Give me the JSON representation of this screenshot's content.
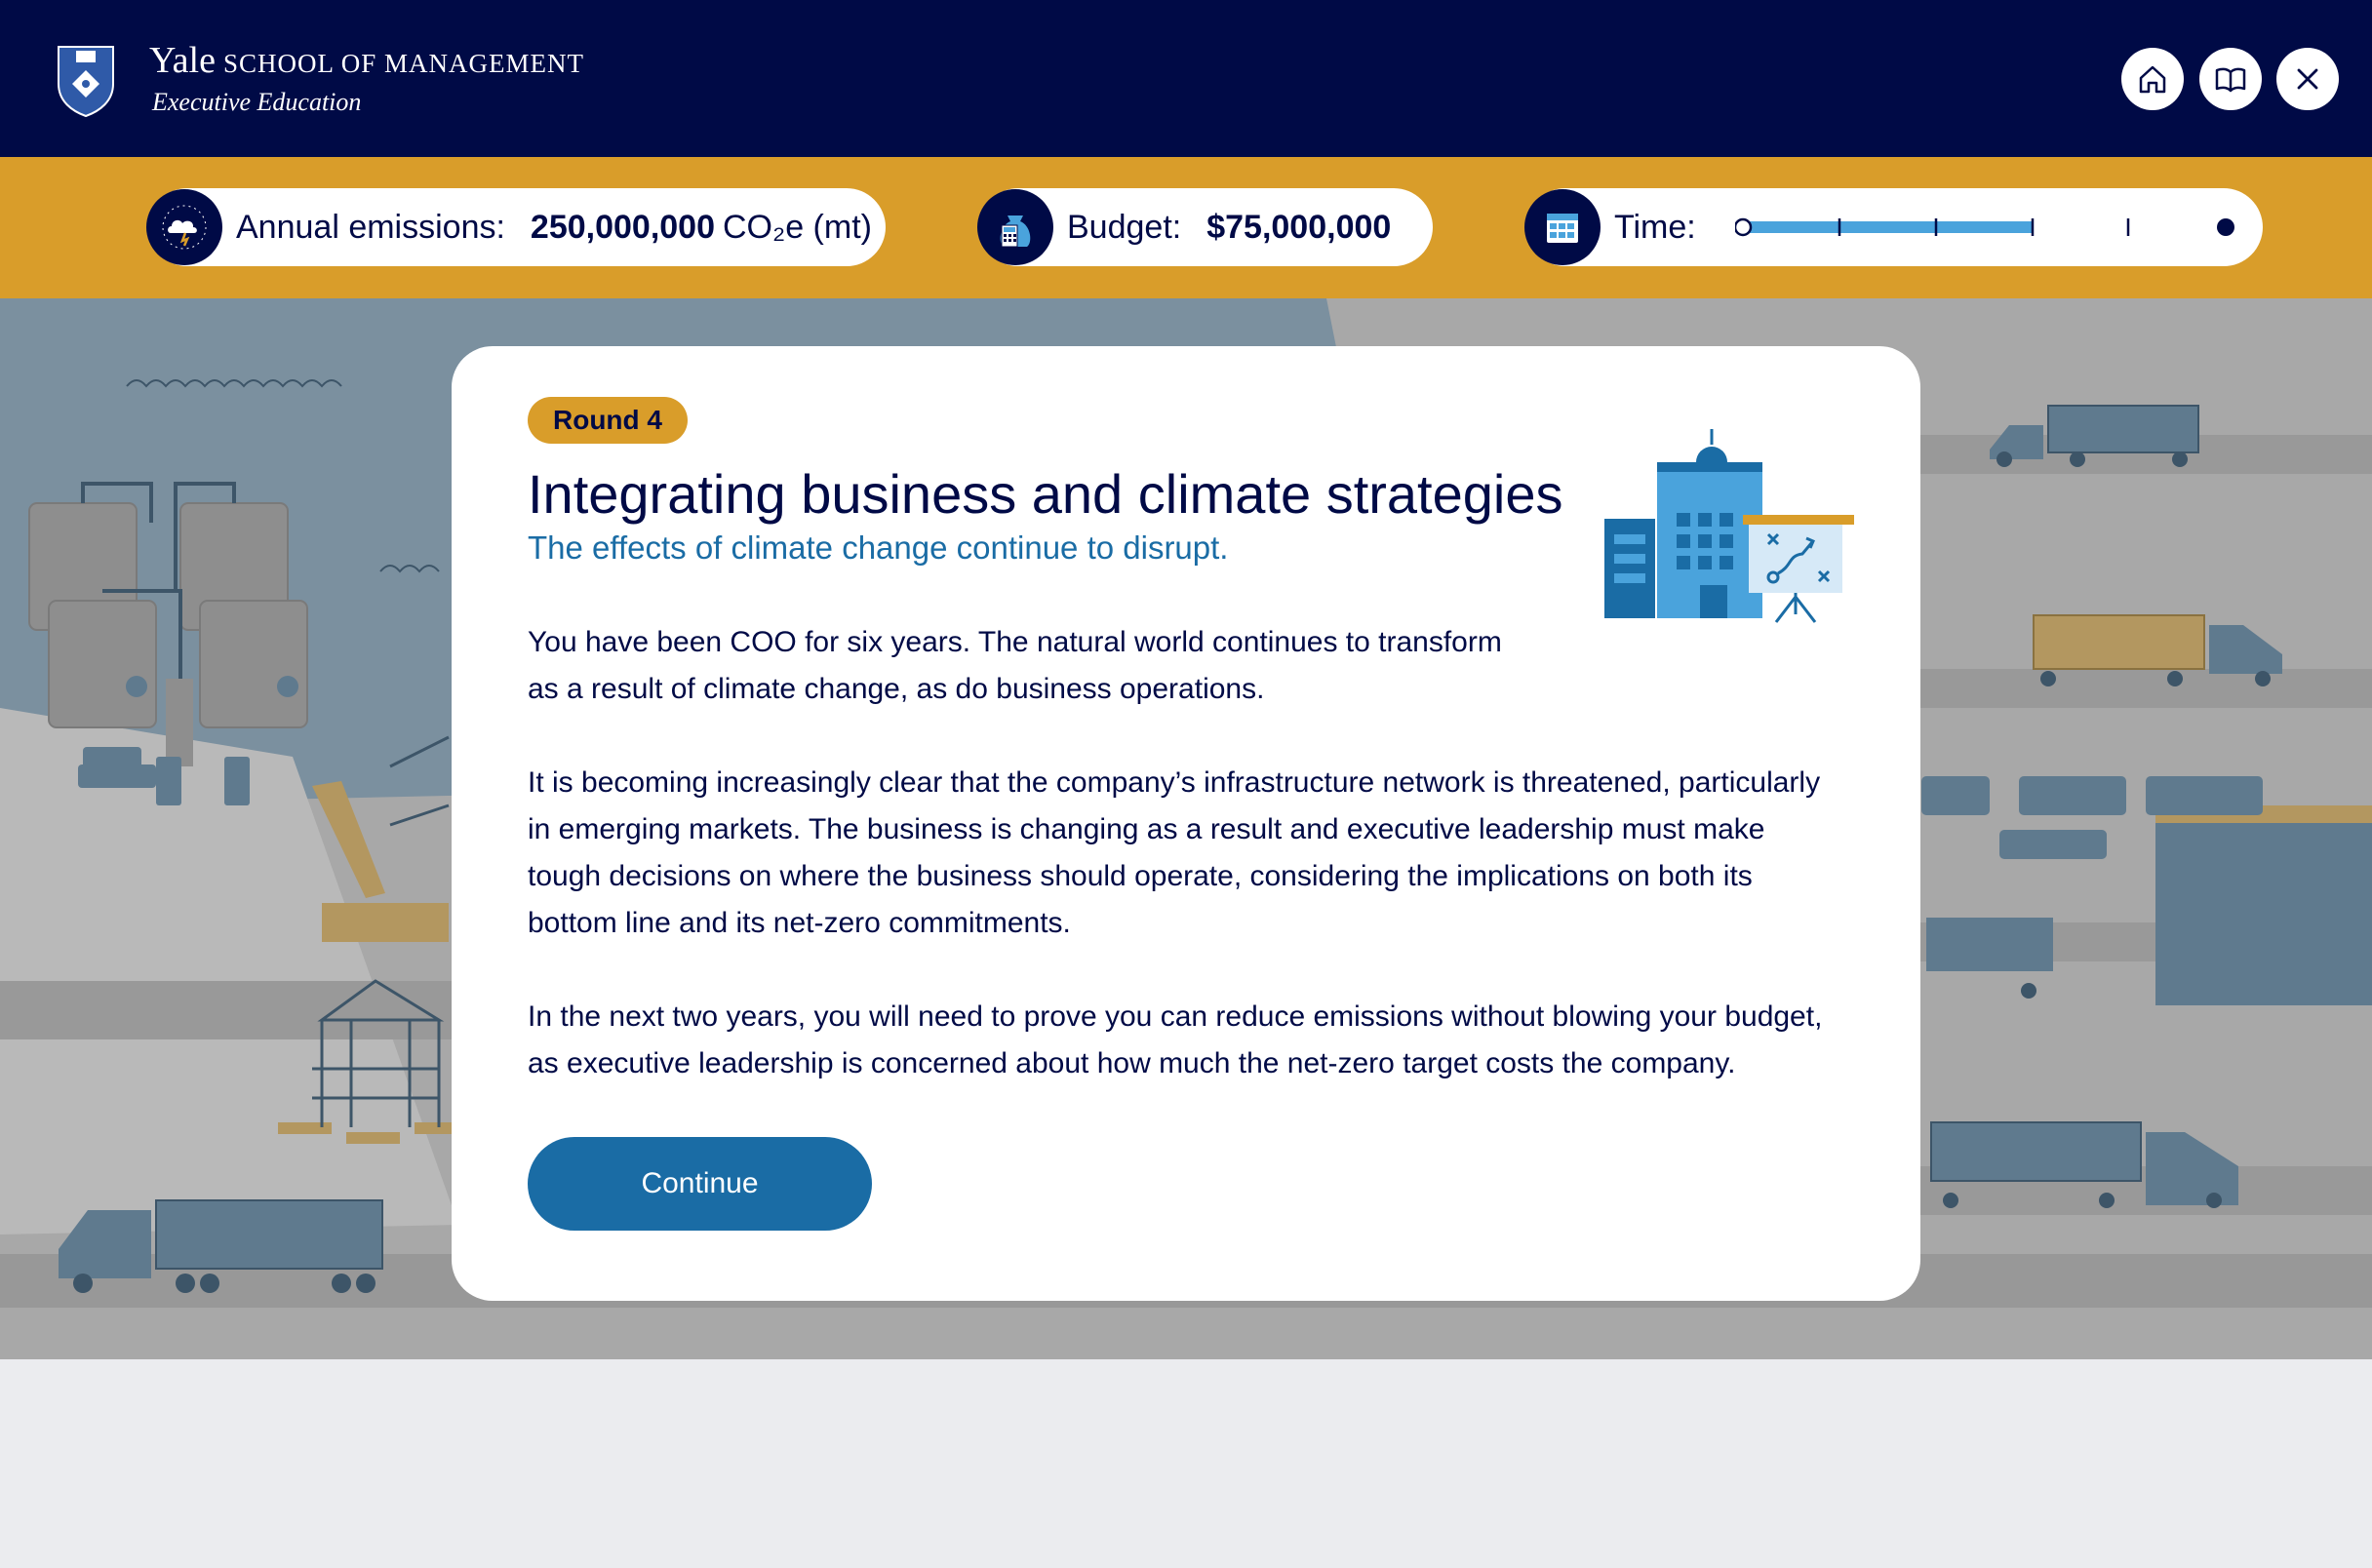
{
  "header": {
    "brand_name": "Yale",
    "brand_school": "SCHOOL OF MANAGEMENT",
    "brand_sub": "Executive Education",
    "buttons": [
      {
        "name": "home-button",
        "icon": "home-icon"
      },
      {
        "name": "guide-button",
        "icon": "book-icon"
      },
      {
        "name": "close-button",
        "icon": "close-icon"
      }
    ]
  },
  "status": {
    "emissions": {
      "label": "Annual emissions:",
      "value": "250,000,000",
      "unit": "CO₂e (mt)",
      "icon": "cloud-sun-icon"
    },
    "budget": {
      "label": "Budget:",
      "value": "$75,000,000",
      "icon": "money-bag-calculator-icon"
    },
    "time": {
      "label": "Time:",
      "icon": "calendar-icon",
      "progress_fraction": 0.6
    }
  },
  "modal": {
    "badge": "Round 4",
    "title": "Integrating business and climate strategies",
    "subtitle": "The effects of climate change continue to disrupt.",
    "paragraphs": [
      "You have been COO for six years. The natural world continues to transform as a result of climate change, as do business operations.",
      "It is becoming increasingly clear that the company’s infrastructure network is threatened, particularly in emerging markets. The business is changing as a result and executive leadership must make tough decisions on where the business should operate, considering the implications on both its bottom line and its net-zero commitments.",
      "In the next two years, you will need to prove you can reduce emissions without blowing your budget, as executive leadership is concerned about how much the net-zero target costs the company."
    ],
    "continue_label": "Continue",
    "illustration": "office-building-strategy-board-icon"
  },
  "colors": {
    "navy": "#000a46",
    "gold": "#d99d2a",
    "blue": "#1a6ca5",
    "light_blue": "#4aa3dc"
  }
}
